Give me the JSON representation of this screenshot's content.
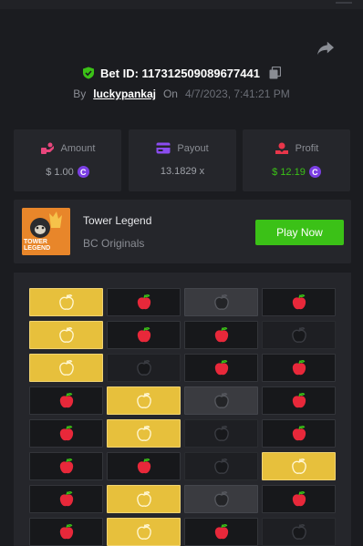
{
  "header": {
    "bet_id_label": "Bet ID: 117312509089677441",
    "by_label": "By",
    "username": "luckypankaj",
    "on_label": "On",
    "date": "4/7/2023, 7:41:21 PM"
  },
  "stats": {
    "amount": {
      "label": "Amount",
      "value": "$ 1.00",
      "icon": "amount-icon"
    },
    "payout": {
      "label": "Payout",
      "value": "13.1829 x",
      "icon": "payout-icon"
    },
    "profit": {
      "label": "Profit",
      "value": "$ 12.19",
      "icon": "profit-icon"
    }
  },
  "game": {
    "title": "Tower Legend",
    "subtitle": "BC Originals",
    "thumb_text": "TOWER LEGEND",
    "play_label": "Play Now"
  },
  "board": {
    "rows": [
      [
        "gold",
        "red",
        "grey",
        "red"
      ],
      [
        "gold",
        "red",
        "red",
        "dark"
      ],
      [
        "gold",
        "dark",
        "red",
        "red"
      ],
      [
        "red",
        "gold",
        "grey",
        "red"
      ],
      [
        "red",
        "gold",
        "dark",
        "red"
      ],
      [
        "red",
        "red",
        "dark",
        "gold"
      ],
      [
        "red",
        "gold",
        "grey",
        "red"
      ],
      [
        "red",
        "gold",
        "red",
        "dark"
      ]
    ]
  },
  "colors": {
    "accent_green": "#3bc117",
    "gold": "#e7c03c",
    "coin_purple": "#7b3fe4"
  }
}
